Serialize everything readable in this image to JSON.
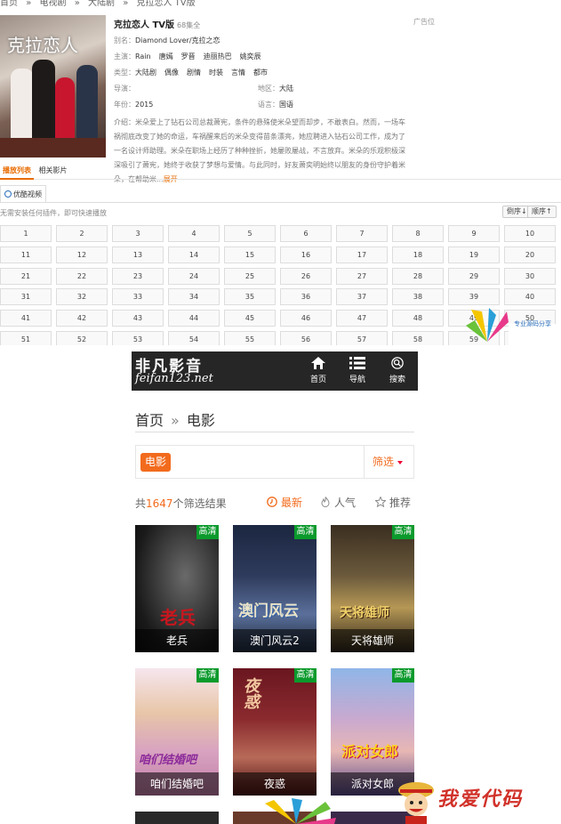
{
  "top": {
    "breadcrumb": [
      "首页",
      "»",
      "电视剧",
      "»",
      "大陆剧",
      "»",
      "克拉恋人 TV版"
    ],
    "poster_text": "克拉恋人",
    "title": "克拉恋人 TV版",
    "episodes_total": "68集全",
    "alias_label": "别名：",
    "alias": "Diamond Lover/克拉之恋",
    "cast_label": "主演：",
    "cast": [
      "Rain",
      "唐嫣",
      "罗晋",
      "迪丽热巴",
      "姚奕辰"
    ],
    "genre_label": "类型：",
    "genre": [
      "大陆剧",
      "偶像",
      "剧情",
      "时装",
      "言情",
      "都市"
    ],
    "director_label": "导演：",
    "director": "",
    "region_label": "地区：",
    "region": "大陆",
    "year_label": "年份：",
    "year": "2015",
    "lang_label": "语言：",
    "lang": "国语",
    "intro_label": "介绍：",
    "intro": "米朵爱上了钻石公司总裁萧宪，条件的悬殊使米朵望而却步，不敢表白。然而，一场车祸彻底改变了她的命运，车祸醒来后的米朵变得苗条漂亮，她应聘进入钻石公司工作，成为了一名设计师助理。米朵在职场上经历了种种挫折，她屡败屡战，不言放弃。米朵的乐观积极深深吸引了萧宪，她终于收获了梦想与爱情。与此同时，好友萧奕明始终以朋友的身份守护着米朵，在帮助米...",
    "intro_more": "展开",
    "ad_label": "广告位",
    "tabs": [
      "播放列表",
      "相关影片"
    ],
    "source_label": "优酷视频",
    "hint": "无需安装任何插件，即可快速播放",
    "sort_desc": "倒序↓",
    "sort_asc": "顺序↑",
    "episodes": [
      "1",
      "2",
      "3",
      "4",
      "5",
      "6",
      "7",
      "8",
      "9",
      "10",
      "11",
      "12",
      "13",
      "14",
      "15",
      "16",
      "17",
      "18",
      "19",
      "20",
      "21",
      "22",
      "23",
      "24",
      "25",
      "26",
      "27",
      "28",
      "29",
      "30",
      "31",
      "32",
      "33",
      "34",
      "35",
      "36",
      "37",
      "38",
      "39",
      "40",
      "41",
      "42",
      "43",
      "44",
      "45",
      "46",
      "47",
      "48",
      "49",
      "50",
      "51",
      "52",
      "53",
      "54",
      "55",
      "56",
      "57",
      "58",
      "59",
      "60"
    ],
    "watermark": "专业源码分享"
  },
  "phone": {
    "logo_cn": "非凡影音",
    "logo_en": "feifan123.net",
    "nav": [
      {
        "label": "首页",
        "icon": "home-icon"
      },
      {
        "label": "导航",
        "icon": "menu-icon"
      },
      {
        "label": "搜索",
        "icon": "search-icon"
      }
    ],
    "breadcrumb": {
      "home": "首页",
      "sep": "»",
      "current": "电影"
    },
    "filter": {
      "tag": "电影",
      "button": "筛选"
    },
    "result": {
      "prefix": "共",
      "count": "1647",
      "suffix": "个筛选结果"
    },
    "sorts": [
      {
        "label": "最新",
        "icon": "clock-icon",
        "active": true
      },
      {
        "label": "人气",
        "icon": "flame-icon",
        "active": false
      },
      {
        "label": "推荐",
        "icon": "star-icon",
        "active": false
      }
    ],
    "hd_badge": "高清",
    "movies": [
      {
        "title": "老兵",
        "art": "老兵"
      },
      {
        "title": "澳门风云2",
        "art": "澳门风云"
      },
      {
        "title": "天将雄师",
        "art": "天将雄师"
      },
      {
        "title": "咱们结婚吧",
        "art": "咱们结婚吧"
      },
      {
        "title": "夜惑",
        "art": "夜惑"
      },
      {
        "title": "派对女郎",
        "art": "派对女郎"
      }
    ]
  },
  "watermark2": "我爱代码",
  "colors": {
    "accent": "#f26b1d",
    "hd": "#0b9a2c",
    "header": "#262626",
    "top_accent": "#e86b00"
  }
}
